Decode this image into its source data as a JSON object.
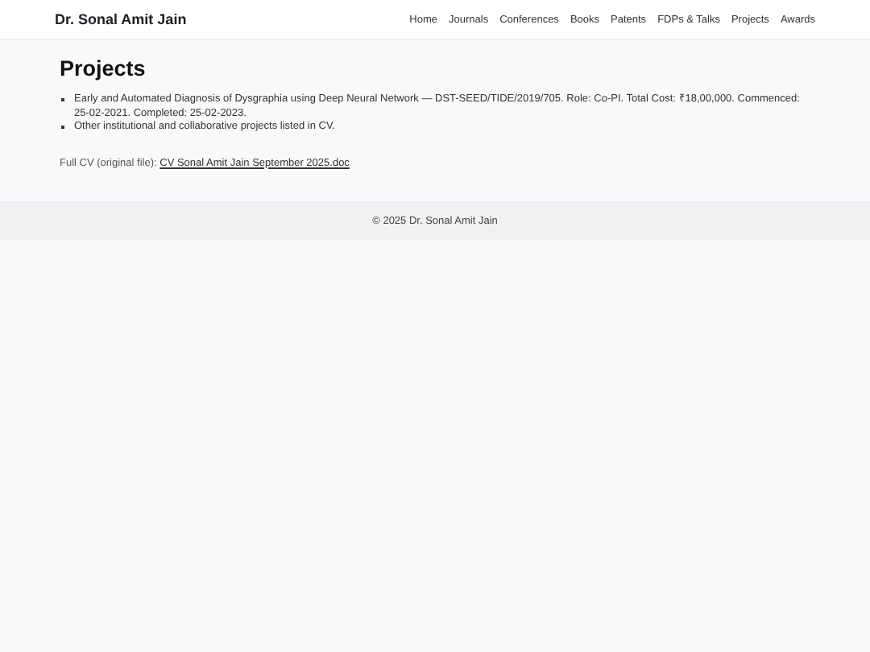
{
  "header": {
    "site_title": "Dr. Sonal Amit Jain",
    "nav": [
      {
        "label": "Home"
      },
      {
        "label": "Journals"
      },
      {
        "label": "Conferences"
      },
      {
        "label": "Books"
      },
      {
        "label": "Patents"
      },
      {
        "label": "FDPs & Talks"
      },
      {
        "label": "Projects"
      },
      {
        "label": "Awards"
      }
    ]
  },
  "main": {
    "heading": "Projects",
    "items": [
      "Early and Automated Diagnosis of Dysgraphia using Deep Neural Network — DST-SEED/TIDE/2019/705. Role: Co-PI. Total Cost: ₹18,00,000. Commenced: 25-02-2021. Completed: 25-02-2023.",
      "Other institutional and collaborative projects listed in CV."
    ],
    "cv_label": "Full CV (original file):",
    "cv_link": "CV Sonal Amit Jain September 2025.doc"
  },
  "footer": {
    "text": "© 2025 Dr. Sonal Amit Jain"
  }
}
